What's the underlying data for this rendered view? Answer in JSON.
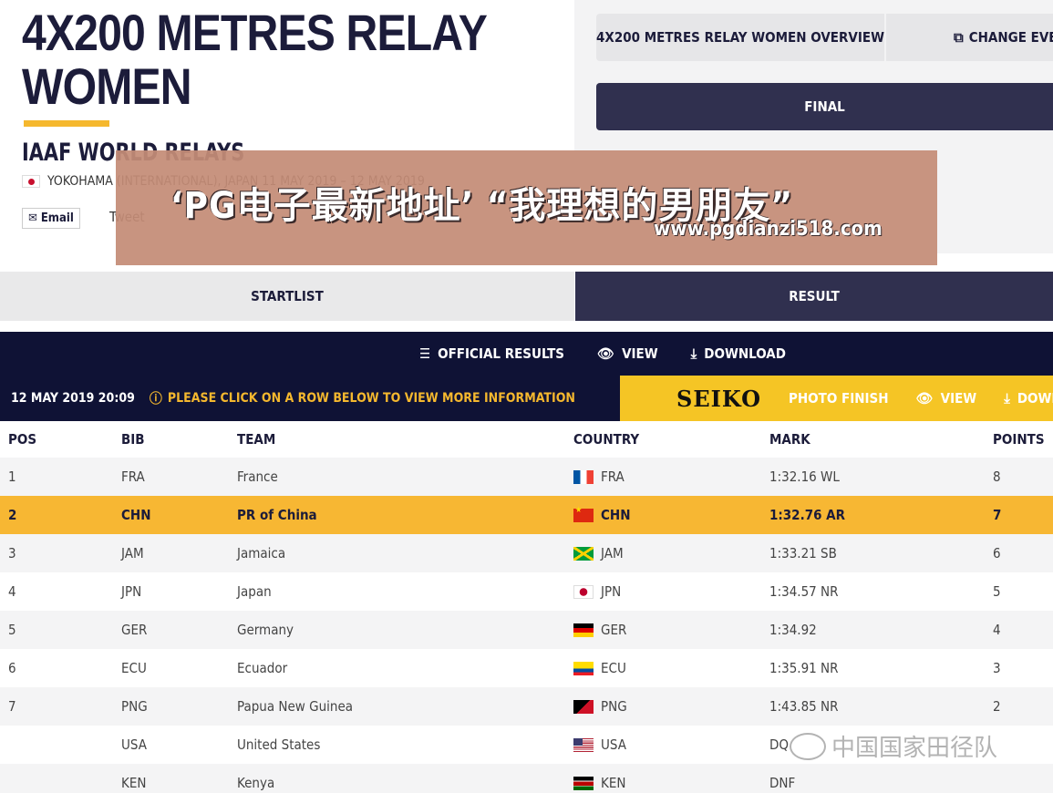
{
  "header": {
    "title_line1": "4X200 METRES RELAY",
    "title_line2": "WOMEN",
    "competition": "IAAF WORLD RELAYS",
    "location": "YOKOHAMA (INTERNATIONAL), JAPAN  11 MAY 2019 – 12 MAY 2019",
    "email_label": "Email",
    "tweet_label": "Tweet"
  },
  "nav": {
    "overview_label": "4X200 METRES RELAY WOMEN OVERVIEW",
    "change_event_label": "CHANGE EVENT",
    "final_label": "FINAL"
  },
  "banner": {
    "text": "‘PG电子最新地址’ “我理想的男朋友”",
    "url": "www.pgdianzi518.com"
  },
  "tabs": {
    "startlist": "STARTLIST",
    "result": "RESULT"
  },
  "results_bar": {
    "official_results": "OFFICIAL RESULTS",
    "view": "VIEW",
    "download": "DOWNLOAD"
  },
  "info_bar": {
    "date": "12 MAY 2019 20:09",
    "note": "PLEASE CLICK ON A ROW BELOW TO VIEW MORE INFORMATION"
  },
  "seiko_bar": {
    "logo": "SEIKO",
    "photo_finish": "PHOTO FINISH",
    "view": "VIEW",
    "download": "DOWNLOAD"
  },
  "table": {
    "headers": [
      "POS",
      "BIB",
      "TEAM",
      "COUNTRY",
      "MARK",
      "POINTS"
    ],
    "rows": [
      {
        "pos": "1",
        "bib": "FRA",
        "team": "France",
        "country": "FRA",
        "mark": "1:32.16 WL",
        "points": "8"
      },
      {
        "pos": "2",
        "bib": "CHN",
        "team": "PR of China",
        "country": "CHN",
        "mark": "1:32.76 AR",
        "points": "7"
      },
      {
        "pos": "3",
        "bib": "JAM",
        "team": "Jamaica",
        "country": "JAM",
        "mark": "1:33.21 SB",
        "points": "6"
      },
      {
        "pos": "4",
        "bib": "JPN",
        "team": "Japan",
        "country": "JPN",
        "mark": "1:34.57 NR",
        "points": "5"
      },
      {
        "pos": "5",
        "bib": "GER",
        "team": "Germany",
        "country": "GER",
        "mark": "1:34.92",
        "points": "4"
      },
      {
        "pos": "6",
        "bib": "ECU",
        "team": "Ecuador",
        "country": "ECU",
        "mark": "1:35.91 NR",
        "points": "3"
      },
      {
        "pos": "7",
        "bib": "PNG",
        "team": "Papua New Guinea",
        "country": "PNG",
        "mark": "1:43.85 NR",
        "points": "2"
      },
      {
        "pos": "",
        "bib": "USA",
        "team": "United States",
        "country": "USA",
        "mark": "DQ",
        "points": ""
      },
      {
        "pos": "",
        "bib": "KEN",
        "team": "Kenya",
        "country": "KEN",
        "mark": "DNF",
        "points": ""
      }
    ]
  },
  "watermark": {
    "text": "中国国家田径队"
  },
  "colors": {
    "navy": "#0f1235",
    "dark_slate": "#30304f",
    "accent_yellow": "#f5b82e",
    "highlight_row": "#f7b733",
    "seiko_yellow": "#f5c525"
  }
}
